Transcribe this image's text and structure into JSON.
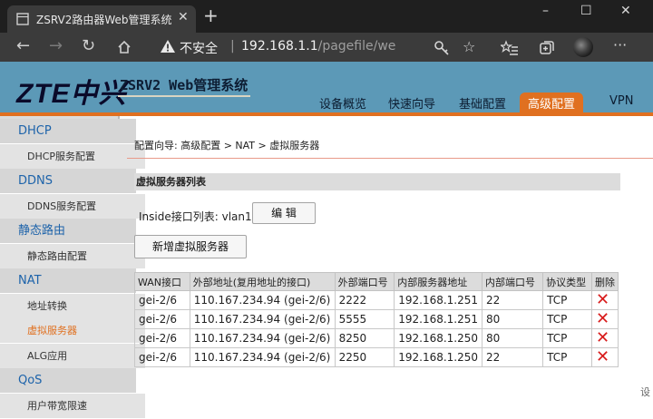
{
  "browser": {
    "tab_title": "ZSRV2路由器Web管理系统",
    "security_label": "不安全",
    "url_host": "192.168.1.1",
    "url_path": "/pagefile/webgui...",
    "new_tab": "+",
    "close_tab": "✕",
    "window_buttons": [
      "–",
      "☐",
      "✕"
    ]
  },
  "router": {
    "logo": "ZTE中兴",
    "system_title": "ZSRV2 Web管理系统",
    "top_menu": [
      {
        "label": "设备概览"
      },
      {
        "label": "快速向导"
      },
      {
        "label": "基础配置"
      },
      {
        "label": "高级配置",
        "active": true
      },
      {
        "label": "VPN"
      }
    ]
  },
  "sidebar": {
    "items": [
      {
        "label": "DHCP",
        "type": "head"
      },
      {
        "label": "DHCP服务配置",
        "type": "sub"
      },
      {
        "label": "DDNS",
        "type": "head"
      },
      {
        "label": "DDNS服务配置",
        "type": "sub"
      },
      {
        "label": "静态路由",
        "type": "head"
      },
      {
        "label": "静态路由配置",
        "type": "sub"
      },
      {
        "label": "NAT",
        "type": "head"
      },
      {
        "label": "地址转换",
        "type": "sub"
      },
      {
        "label": "虚拟服务器",
        "type": "sub",
        "active": true
      },
      {
        "label": "ALG应用",
        "type": "sub"
      },
      {
        "label": "QoS",
        "type": "head"
      },
      {
        "label": "用户带宽限速",
        "type": "sub"
      }
    ]
  },
  "main": {
    "breadcrumb": "配置向导: 高级配置 > NAT > 虚拟服务器",
    "section_title": "虚拟服务器列表",
    "inside_label": "Inside接口列表: vlan1",
    "edit_button": "编 辑",
    "add_button": "新增虚拟服务器",
    "table": {
      "headers": [
        "WAN接口",
        "外部地址(复用地址的接口)",
        "外部端口号",
        "内部服务器地址",
        "内部端口号",
        "协议类型",
        "删除"
      ],
      "rows": [
        [
          "gei-2/6",
          "110.167.234.94 (gei-2/6)",
          "2222",
          "192.168.1.251",
          "22",
          "TCP"
        ],
        [
          "gei-2/6",
          "110.167.234.94 (gei-2/6)",
          "5555",
          "192.168.1.251",
          "80",
          "TCP"
        ],
        [
          "gei-2/6",
          "110.167.234.94 (gei-2/6)",
          "8250",
          "192.168.1.250",
          "80",
          "TCP"
        ],
        [
          "gei-2/6",
          "110.167.234.94 (gei-2/6)",
          "2250",
          "192.168.1.250",
          "22",
          "TCP"
        ]
      ],
      "delete_glyph": "✕"
    },
    "edge_text": "设"
  },
  "colors": {
    "header_bg": "#5c99b7",
    "accent": "#e07020",
    "sidebar_bg": "#dcdcdc",
    "link_blue": "#1d63aa",
    "delete_red": "#d81b1b"
  }
}
